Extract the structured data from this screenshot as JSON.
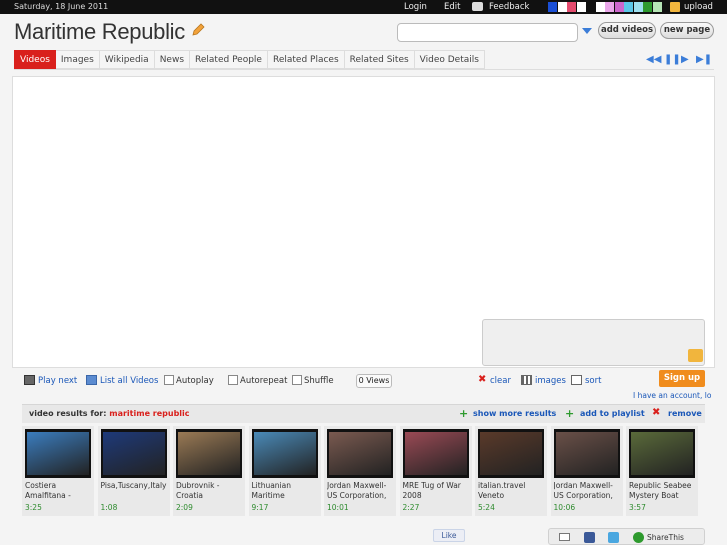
{
  "topbar": {
    "date": "Saturday, 18 June 2011",
    "login": "Login",
    "edit": "Edit",
    "feedback": "Feedback",
    "upload": "upload",
    "swatches": [
      "#1a4fd6",
      "#ffffff",
      "#e44b6e",
      "#ffffff",
      "#111111",
      "#ffffff",
      "#e9a6e9",
      "#cc66cc",
      "#5bc7e8",
      "#9ee0f0",
      "#2e9a2e",
      "#b6e5b6"
    ]
  },
  "header": {
    "title": "Maritime Republic",
    "search_value": "",
    "add_videos": "add videos",
    "new_page": "new page"
  },
  "tabs": [
    "Videos",
    "Images",
    "Wikipedia",
    "News",
    "Related People",
    "Related Places",
    "Related Sites",
    "Video Details"
  ],
  "controls": {
    "play_next": "Play next",
    "list_all": "List all Videos",
    "autoplay": "Autoplay",
    "autorepeat": "Autorepeat",
    "shuffle": "Shuffle",
    "views": "0 Views",
    "clear": "clear",
    "images": "images",
    "sort": "sort",
    "sign_up": "Sign up",
    "account": "I have an account, lo"
  },
  "results": {
    "label": "video results for:",
    "query": "maritime republic",
    "show_more": "show more results",
    "add_playlist": "add to playlist",
    "remove": "remove"
  },
  "videos": [
    {
      "title": "Costiera Amalfitana -",
      "duration": "3:25",
      "color": "#3b7dbf"
    },
    {
      "title": "Pisa,Tuscany,Italy",
      "duration": "1:08",
      "color": "#1e3a7a"
    },
    {
      "title": "Dubrovnik - Croatia",
      "duration": "2:09",
      "color": "#9a7a55"
    },
    {
      "title": "Lithuanian Maritime",
      "duration": "9:17",
      "color": "#4a8ab8"
    },
    {
      "title": "Jordan Maxwell- US Corporation,",
      "duration": "10:01",
      "color": "#7a5a50"
    },
    {
      "title": "MRE Tug of War 2008",
      "duration": "2:27",
      "color": "#9a4a55"
    },
    {
      "title": "italian.travel Veneto",
      "duration": "5:24",
      "color": "#5a3a2a"
    },
    {
      "title": "Jordan Maxwell- US Corporation,",
      "duration": "10:06",
      "color": "#6a5048"
    },
    {
      "title": "Republic Seabee Mystery Boat",
      "duration": "3:57",
      "color": "#5a6a3a"
    }
  ],
  "social": {
    "like": "Like",
    "share_this": "ShareThis"
  }
}
